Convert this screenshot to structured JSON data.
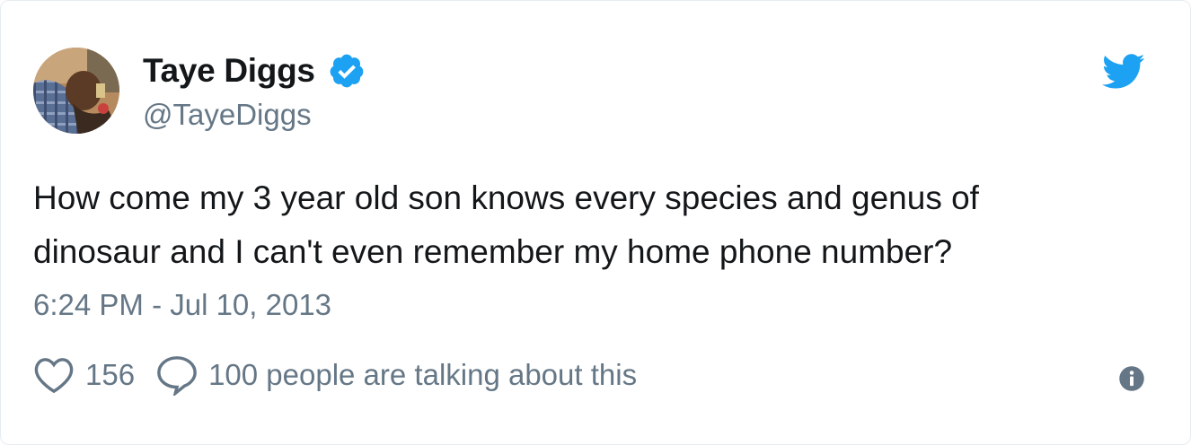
{
  "tweet": {
    "author": {
      "display_name": "Taye Diggs",
      "handle": "@TayeDiggs",
      "verified": true
    },
    "text_line1": "How come my 3 year old son knows every species and genus of",
    "text_line2": "dinosaur and I can't even remember my home phone number?",
    "timestamp": "6:24 PM - Jul 10, 2013",
    "likes": "156",
    "talking": "100 people are talking about this"
  },
  "icons": {
    "brand": "twitter-bird-icon",
    "like": "heart-icon",
    "reply": "speech-bubble-icon",
    "info": "info-icon",
    "verified": "verified-badge-icon"
  },
  "colors": {
    "brand_blue": "#1da1f2",
    "text": "#14171a",
    "secondary": "#657786"
  }
}
